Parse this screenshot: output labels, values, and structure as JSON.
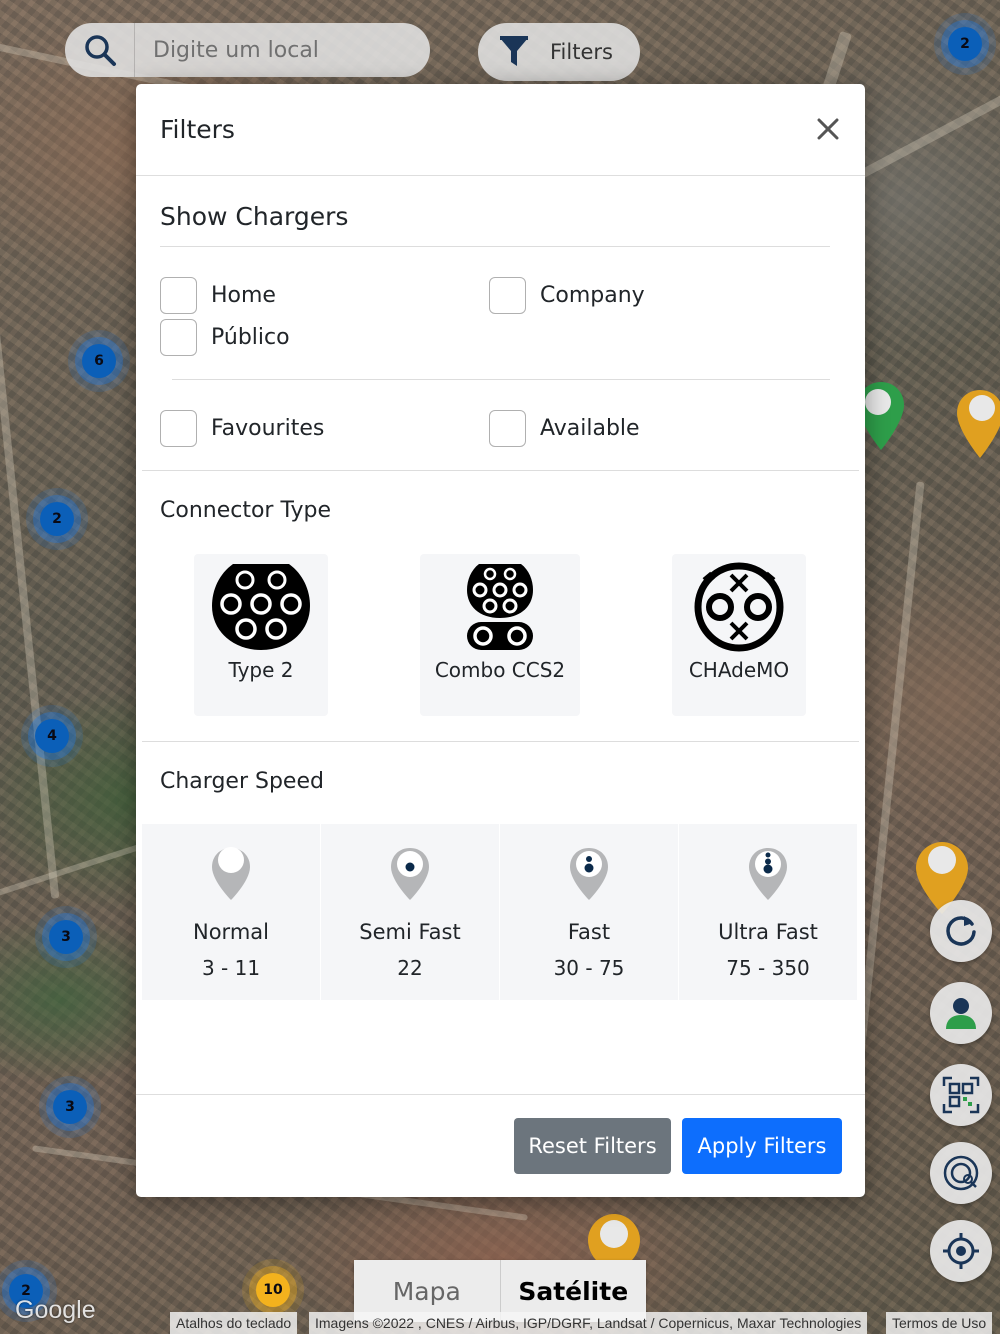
{
  "search": {
    "placeholder": "Digite um local"
  },
  "filters_pill": {
    "label": "Filters"
  },
  "map": {
    "clusters": [
      "2",
      "6",
      "2",
      "4",
      "3",
      "3",
      "2"
    ],
    "orange_cluster": "10",
    "type_toggle": {
      "map": "Mapa",
      "satellite": "Satélite",
      "selected": "Satélite"
    },
    "logo": "Google",
    "attribution": {
      "shortcuts": "Atalhos do teclado",
      "imagery": "Imagens ©2022 , CNES / Airbus, IGP/DGRF, Landsat / Copernicus, Maxar Technologies",
      "terms": "Termos de Uso"
    }
  },
  "modal": {
    "title": "Filters",
    "show_chargers": {
      "title": "Show Chargers",
      "options": [
        {
          "label": "Home",
          "checked": false
        },
        {
          "label": "Company",
          "checked": false
        },
        {
          "label": "Público",
          "checked": false
        }
      ],
      "extra": [
        {
          "label": "Favourites",
          "checked": false
        },
        {
          "label": "Available",
          "checked": false
        }
      ]
    },
    "connector_type": {
      "title": "Connector Type",
      "items": [
        {
          "label": "Type 2",
          "icon": "type2-connector-icon"
        },
        {
          "label": "Combo CCS2",
          "icon": "ccs2-connector-icon"
        },
        {
          "label": "CHAdeMO",
          "icon": "chademo-connector-icon"
        }
      ]
    },
    "charger_speed": {
      "title": "Charger Speed",
      "items": [
        {
          "name": "Normal",
          "range": "3 - 11"
        },
        {
          "name": "Semi Fast",
          "range": "22"
        },
        {
          "name": "Fast",
          "range": "30 - 75"
        },
        {
          "name": "Ultra Fast",
          "range": "75 - 350"
        }
      ]
    },
    "buttons": {
      "reset": "Reset Filters",
      "apply": "Apply Filters"
    }
  },
  "colors": {
    "primary": "#0d6efd",
    "secondary": "#6c757d",
    "cluster": "#0b5fb8",
    "cluster_orange": "#f3b21d"
  }
}
